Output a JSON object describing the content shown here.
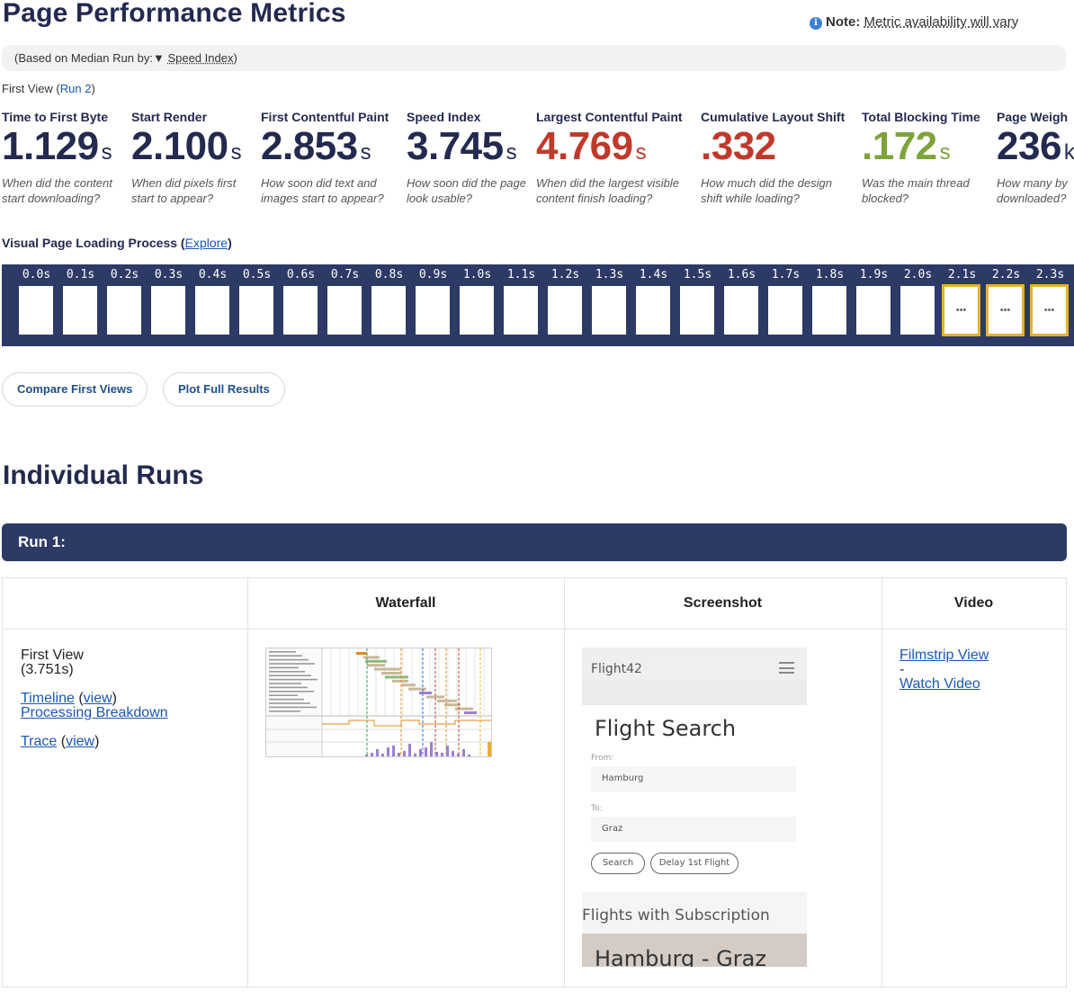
{
  "header": {
    "title": "Page Performance Metrics",
    "note_label": "Note:",
    "note_text": "Metric availability will vary"
  },
  "median": {
    "prefix": "(Based on Median Run by:",
    "arrow": "▼",
    "metric": "Speed Index",
    "suffix": ")"
  },
  "first_view": {
    "label": "First View (",
    "run_link": "Run 2",
    "close": ")"
  },
  "metrics": [
    {
      "label": "Time to First Byte",
      "value": "1.129",
      "unit": "s",
      "question": "When did the content start downloading?",
      "color": "#232a4f"
    },
    {
      "label": "Start Render",
      "value": "2.100",
      "unit": "s",
      "question": "When did pixels first start to appear?",
      "color": "#232a4f"
    },
    {
      "label": "First Contentful Paint",
      "value": "2.853",
      "unit": "s",
      "question": "How soon did text and images start to appear?",
      "color": "#232a4f"
    },
    {
      "label": "Speed Index",
      "value": "3.745",
      "unit": "s",
      "question": "How soon did the page look usable?",
      "color": "#232a4f"
    },
    {
      "label": "Largest Contentful Paint",
      "value": "4.769",
      "unit": "s",
      "question": "When did the largest visible content finish loading?",
      "color": "#c0392b"
    },
    {
      "label": "Cumulative Layout Shift",
      "value": ".332",
      "unit": "",
      "question": "How much did the design shift while loading?",
      "color": "#c0392b"
    },
    {
      "label": "Total Blocking Time",
      "value": ".172",
      "unit": "s",
      "question": "Was the main thread blocked?",
      "color": "#7ea33a"
    },
    {
      "label": "Page Weigh",
      "value": "236",
      "unit": "k",
      "question": "How many by downloaded?",
      "color": "#232a4f"
    }
  ],
  "visual_process": {
    "label": "Visual Page Loading Process",
    "open": " (",
    "link": "Explore",
    "close": ")"
  },
  "filmstrip": {
    "times": [
      "0.0s",
      "0.1s",
      "0.2s",
      "0.3s",
      "0.4s",
      "0.5s",
      "0.6s",
      "0.7s",
      "0.8s",
      "0.9s",
      "1.0s",
      "1.1s",
      "1.2s",
      "1.3s",
      "1.4s",
      "1.5s",
      "1.6s",
      "1.7s",
      "1.8s",
      "1.9s",
      "2.0s",
      "2.1s",
      "2.2s",
      "2.3s"
    ],
    "changed_from_index": 21,
    "changed_glyph": "•••"
  },
  "buttons": {
    "compare": "Compare First Views",
    "plot": "Plot Full Results"
  },
  "runs": {
    "heading": "Individual Runs",
    "run_title": "Run 1:",
    "columns": [
      "",
      "Waterfall",
      "Screenshot",
      "Video"
    ],
    "view_name": "First View",
    "view_time": "(3.751s)",
    "timeline": "Timeline",
    "view_link": "view",
    "processing": "Processing Breakdown",
    "trace": "Trace",
    "filmstrip_view": "Filmstrip View",
    "dash": "-",
    "watch_video": "Watch Video"
  },
  "screenshot": {
    "brand": "Flight42",
    "heading": "Flight Search",
    "from_label": "From:",
    "from_value": "Hamburg",
    "to_label": "To:",
    "to_value": "Graz",
    "search_btn": "Search",
    "delay_btn": "Delay 1st Flight",
    "subscription": "Flights with Subscription",
    "route": "Hamburg - Graz"
  }
}
